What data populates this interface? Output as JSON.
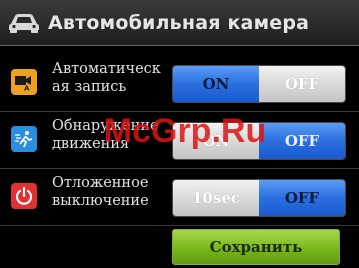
{
  "header": {
    "title": "Автомобильная камера",
    "icon": "car-icon"
  },
  "settings": [
    {
      "label_line1": "Автоматическ",
      "label_line2": "ая запись",
      "icon": "camera-record-icon",
      "icon_color": "#f0a020",
      "options": [
        "ON",
        "OFF"
      ],
      "selected": "ON"
    },
    {
      "label_line1": "Обнаружение",
      "label_line2": "движения",
      "icon": "motion-detect-icon",
      "icon_color": "#2a8ee0",
      "options": [
        "ON",
        "OFF"
      ],
      "selected": "OFF"
    },
    {
      "label_line1": "Отложенное",
      "label_line2": "выключение",
      "icon": "power-icon",
      "icon_color": "#e03030",
      "options": [
        "10sec",
        "OFF"
      ],
      "selected": "OFF"
    }
  ],
  "save_button": {
    "label": "Сохранить",
    "color": "#7ab820"
  },
  "watermark": {
    "text": "McGrp.Ru"
  }
}
